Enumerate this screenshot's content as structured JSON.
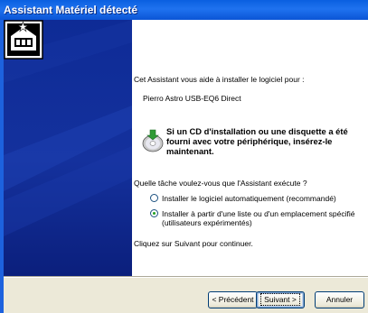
{
  "window": {
    "title": "Assistant Matériel détecté"
  },
  "intro": {
    "text": "Cet Assistant vous aide à installer le logiciel pour :"
  },
  "device": {
    "name": "Pierro Astro USB-EQ6 Direct"
  },
  "cd_prompt": {
    "line1": "Si un CD d'installation ou une disquette a été",
    "line2": "fourni avec votre périphérique, insérez-le",
    "line3": "maintenant."
  },
  "question": {
    "text": "Quelle tâche voulez-vous que l'Assistant exécute ?"
  },
  "options": [
    {
      "label": "Installer le logiciel automatiquement (recommandé)",
      "checked": false
    },
    {
      "label_line1": "Installer à partir d'une liste ou d'un emplacement spécifié",
      "label_line2": "(utilisateurs expérimentés)",
      "checked": true
    }
  ],
  "instruction": {
    "text": "Cliquez sur Suivant pour continuer."
  },
  "buttons": {
    "back": "< Précédent",
    "next": "Suivant >",
    "cancel": "Annuler"
  },
  "icons": {
    "hardware": "hardware-card-icon",
    "cd": "cd-disc-icon"
  },
  "colors": {
    "titlebar": "#0a5fe0",
    "side_panel": "#14319d",
    "dialog_bg": "#ece9d8",
    "radio_checked": "#21a121"
  }
}
